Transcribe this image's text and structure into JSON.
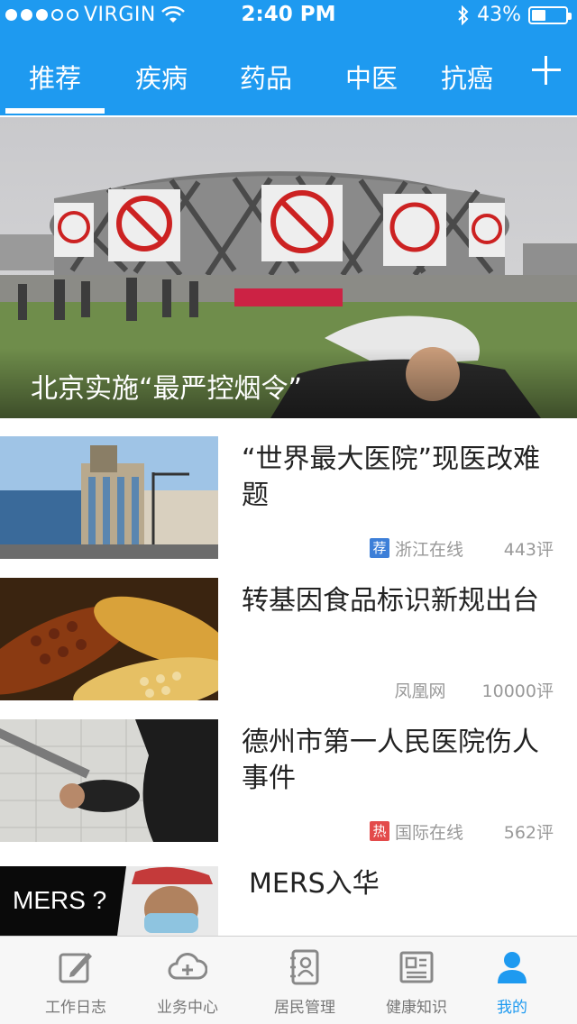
{
  "status_bar": {
    "carrier": "VIRGIN",
    "time": "2:40 PM",
    "battery": "43%",
    "battery_level": 0.43
  },
  "top_tabs": [
    {
      "label": "推荐",
      "active": true
    },
    {
      "label": "疾病",
      "active": false
    },
    {
      "label": "药品",
      "active": false
    },
    {
      "label": "中医",
      "active": false
    },
    {
      "label": "抗癌",
      "active": false
    }
  ],
  "add_tab_icon": "plus-icon",
  "hero": {
    "caption": "北京实施“最严控烟令”"
  },
  "news": [
    {
      "title": "“世界最大医院”现医改难题",
      "badge": "荐",
      "badge_color": "#3d7fd8",
      "source": "浙江在线",
      "comments": "443评"
    },
    {
      "title": "转基因食品标识新规出台",
      "badge": "",
      "badge_color": "",
      "source": "凤凰网",
      "comments": "10000评"
    },
    {
      "title": "德州市第一人民医院伤人事件",
      "badge": "热",
      "badge_color": "#e34b4b",
      "source": "国际在线",
      "comments": "562评"
    },
    {
      "title": "MERS入华",
      "thumb_text": "MERS ?"
    }
  ],
  "bottom_tabs": [
    {
      "label": "工作日志",
      "icon": "edit-icon",
      "active": false
    },
    {
      "label": "业务中心",
      "icon": "cloud-add-icon",
      "active": false
    },
    {
      "label": "居民管理",
      "icon": "contacts-book-icon",
      "active": false
    },
    {
      "label": "健康知识",
      "icon": "newspaper-icon",
      "active": false
    },
    {
      "label": "我的",
      "icon": "user-icon",
      "active": true
    }
  ],
  "colors": {
    "primary": "#1e9af0",
    "inactive": "#777777"
  }
}
